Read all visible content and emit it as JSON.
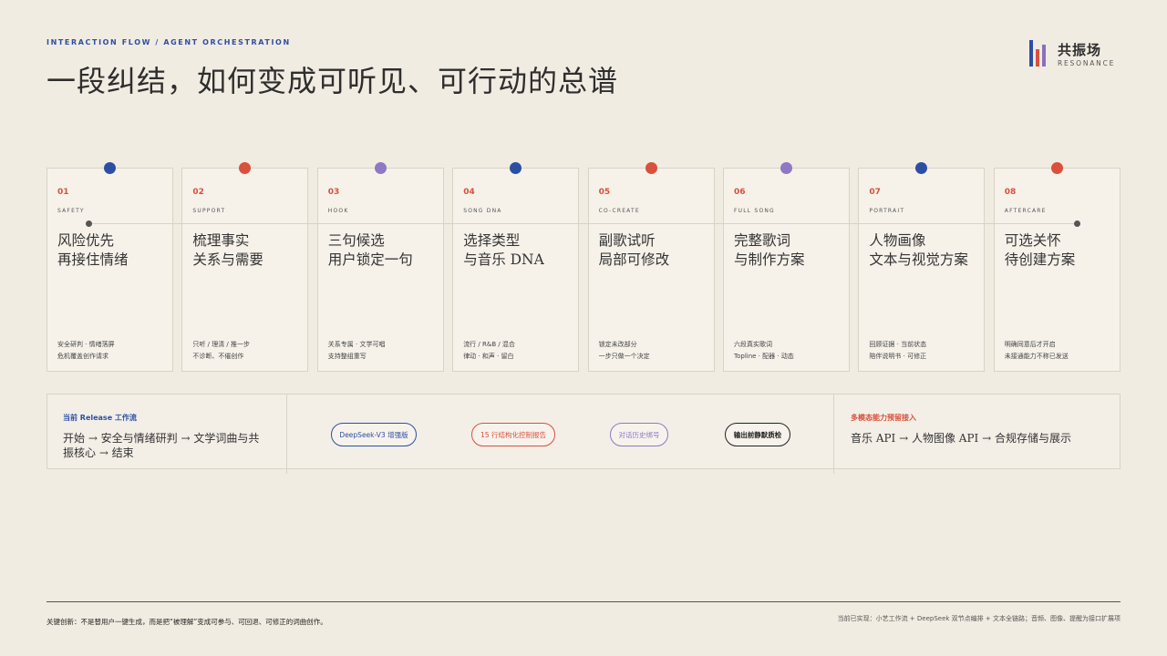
{
  "header": {
    "eyebrow": "INTERACTION FLOW / AGENT ORCHESTRATION",
    "title": "一段纠结，如何变成可听见、可行动的总谱"
  },
  "logo": {
    "name": "共振场",
    "sub": "RESONANCE",
    "bar_colors": [
      "#2d4fa3",
      "#d9503c",
      "#8a6fbf"
    ]
  },
  "colors": {
    "blue": "#2d4fa3",
    "red": "#d9503c",
    "purple": "#8f78c4",
    "accent_number": "#d9503c"
  },
  "cards": [
    {
      "num": "01",
      "tag": "SAFETY",
      "dot": "#2d4fa3",
      "title1": "风险优先",
      "title2": "再接住情绪",
      "desc1": "安全研判 · 情绪落屏",
      "desc2": "危机覆盖创作请求"
    },
    {
      "num": "02",
      "tag": "SUPPORT",
      "dot": "#d9503c",
      "title1": "梳理事实",
      "title2": "关系与需要",
      "desc1": "只听 / 理清 / 推一步",
      "desc2": "不诊断、不催创作"
    },
    {
      "num": "03",
      "tag": "HOOK",
      "dot": "#8f78c4",
      "title1": "三句候选",
      "title2": "用户锁定一句",
      "desc1": "关系专属 · 文学可唱",
      "desc2": "支持整组重写"
    },
    {
      "num": "04",
      "tag": "SONG DNA",
      "dot": "#2d4fa3",
      "title1": "选择类型",
      "title2": "与音乐 DNA",
      "desc1": "流行 / R&B / 混合",
      "desc2": "律动 · 和声 · 留白"
    },
    {
      "num": "05",
      "tag": "CO-CREATE",
      "dot": "#d9503c",
      "title1": "副歌试听",
      "title2": "局部可修改",
      "desc1": "锁定未改部分",
      "desc2": "一步只做一个决定"
    },
    {
      "num": "06",
      "tag": "FULL SONG",
      "dot": "#8f78c4",
      "title1": "完整歌词",
      "title2": "与制作方案",
      "desc1": "六段真实歌词",
      "desc2": "Topline · 配器 · 动态"
    },
    {
      "num": "07",
      "tag": "PORTRAIT",
      "dot": "#2d4fa3",
      "title1": "人物画像",
      "title2": "文本与视觉方案",
      "desc1": "回顾证据 · 当前状态",
      "desc2": "陪伴说明书 · 可修正"
    },
    {
      "num": "08",
      "tag": "AFTERCARE",
      "dot": "#d9503c",
      "title1": "可选关怀",
      "title2": "待创建方案",
      "desc1": "明确同意后才开启",
      "desc2": "未接通能力不称已发送"
    }
  ],
  "release": {
    "head": "当前 Release 工作流",
    "text1": "开始 → 安全与情绪研判 → 文学词曲与共",
    "text2": "振核心 → 结束"
  },
  "pills": [
    {
      "label": "DeepSeek-V3 增强版",
      "color": "#2d4fa3"
    },
    {
      "label": "15 行结构化控制报告",
      "color": "#d9503c"
    },
    {
      "label": "对话历史绑号",
      "color": "#8f78c4"
    },
    {
      "label": "输出前静默质检",
      "color": "#222222"
    }
  ],
  "multimodal": {
    "head": "多模态能力预留接入",
    "text": "音乐 API → 人物图像 API → 合规存储与展示"
  },
  "footer": {
    "left": "关键创新：不是替用户一键生成，而是把“被理解”变成可参与、可回退、可修正的词曲创作。",
    "right": "当前已实现：小艺工作流 + DeepSeek 双节点编排 + 文本全链路；音频、图像、提醒为接口扩展项"
  }
}
